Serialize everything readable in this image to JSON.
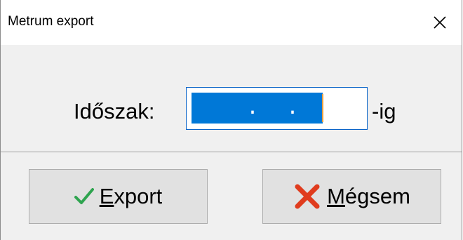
{
  "window": {
    "title": "Metrum export",
    "close_glyph": "✕"
  },
  "form": {
    "period_label": "Időszak:",
    "date_value": "    .  .  ",
    "suffix": "-ig"
  },
  "buttons": {
    "export": {
      "mnemonic": "E",
      "rest": "xport",
      "icon": "checkmark-icon",
      "icon_color": "#2ea44f"
    },
    "cancel": {
      "mnemonic": "M",
      "rest": "égsem",
      "icon": "red-x-icon",
      "icon_color": "#e03c1e"
    }
  },
  "colors": {
    "selection": "#0078d7",
    "focus_border": "#0a64c8"
  }
}
